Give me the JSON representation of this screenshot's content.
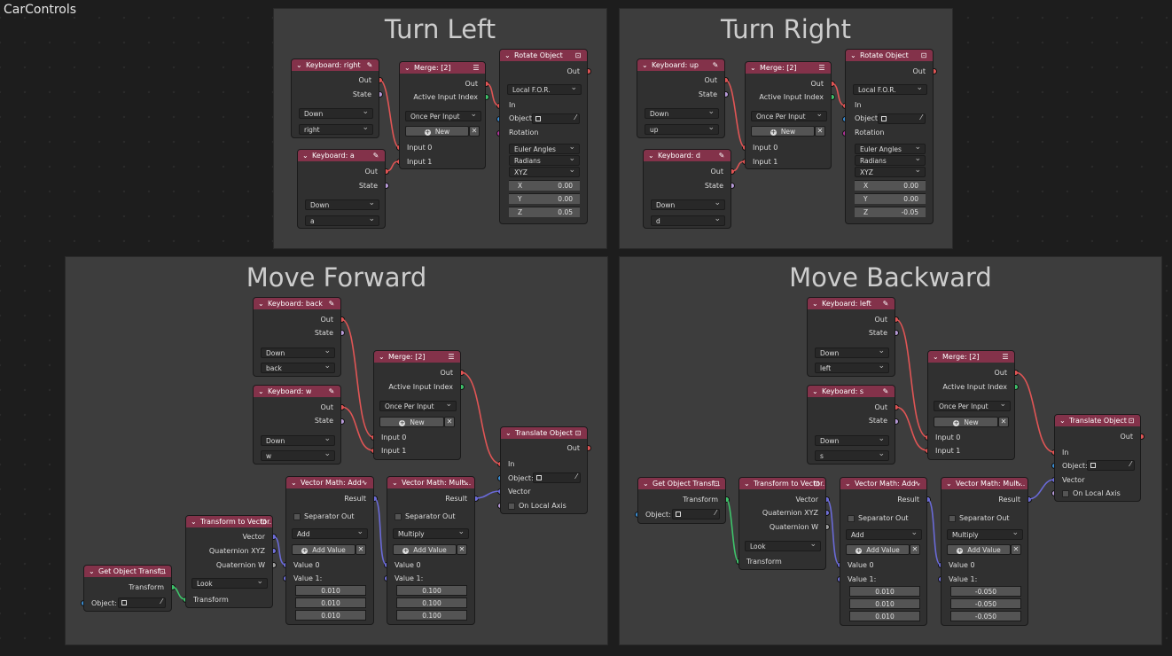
{
  "tree_title": "CarControls",
  "frames": {
    "turn_left": "Turn Left",
    "turn_right": "Turn Right",
    "move_forward": "Move Forward",
    "move_backward": "Move Backward"
  },
  "common": {
    "out": "Out",
    "state": "State",
    "down": "Down",
    "once_per_input": "Once Per Input",
    "new": "New",
    "active_input_index": "Active Input Index",
    "input0": "Input 0",
    "input1": "Input 1",
    "in": "In",
    "object": "Object:",
    "rotation": "Rotation",
    "local_for": "Local F.O.R.",
    "euler_angles": "Euler Angles",
    "radians": "Radians",
    "xyz": "XYZ",
    "x": "X",
    "y": "Y",
    "z": "Z",
    "vector": "Vector",
    "on_local_axis": "On Local Axis",
    "result": "Result",
    "separator_out": "Separator Out",
    "add": "Add",
    "multiply": "Multiply",
    "add_value": "Add Value",
    "value0": "Value 0",
    "value1": "Value 1:",
    "transform": "Transform",
    "quaternion_xyz": "Quaternion XYZ",
    "quaternion_w": "Quaternion W",
    "look": "Look"
  },
  "titles": {
    "merge": "Merge: [2]",
    "rotate": "Rotate Object",
    "translate": "Translate Object",
    "get_transform": "Get Object Transf...",
    "to_vector": "Transform to Vector...",
    "vmath_add": "Vector Math: Add",
    "vmath_mult": "Vector Math: Mult..."
  },
  "turn_left": {
    "key1": {
      "title": "Keyboard: right",
      "key": "right"
    },
    "key2": {
      "title": "Keyboard: a",
      "key": "a"
    },
    "rotation": {
      "x": "0.00",
      "y": "0.00",
      "z": "0.05"
    }
  },
  "turn_right": {
    "key1": {
      "title": "Keyboard: up",
      "key": "up"
    },
    "key2": {
      "title": "Keyboard: d",
      "key": "d"
    },
    "rotation": {
      "x": "0.00",
      "y": "0.00",
      "z": "-0.05"
    }
  },
  "move_forward": {
    "key1": {
      "title": "Keyboard: back",
      "key": "back"
    },
    "key2": {
      "title": "Keyboard: w",
      "key": "w"
    },
    "add_values": [
      "0.010",
      "0.010",
      "0.010"
    ],
    "mult_values": [
      "0.100",
      "0.100",
      "0.100"
    ]
  },
  "move_backward": {
    "key1": {
      "title": "Keyboard: left",
      "key": "left"
    },
    "key2": {
      "title": "Keyboard: s",
      "key": "s"
    },
    "add_values": [
      "0.010",
      "0.010",
      "0.010"
    ],
    "mult_values": [
      "-0.050",
      "-0.050",
      "-0.050"
    ]
  },
  "colors": {
    "header": "#83324a",
    "frame": "#3d3d3d",
    "node": "#303030",
    "wire_red": "#e05555",
    "wire_blue": "#6a6ad8",
    "wire_green": "#3ec26a"
  }
}
